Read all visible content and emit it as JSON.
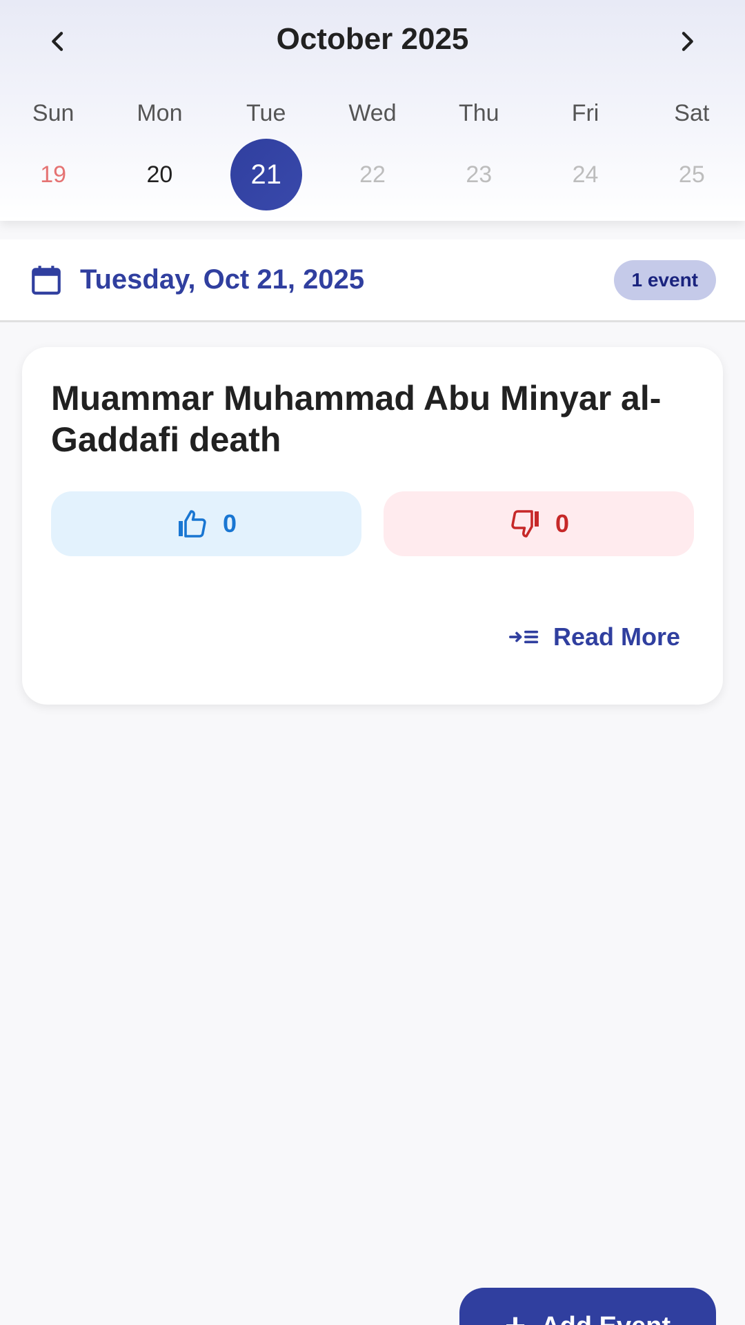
{
  "calendar": {
    "month_title": "October 2025",
    "weekdays": [
      "Sun",
      "Mon",
      "Tue",
      "Wed",
      "Thu",
      "Fri",
      "Sat"
    ],
    "days": [
      "19",
      "20",
      "21",
      "22",
      "23",
      "24",
      "25"
    ],
    "selected_day": "21",
    "colors": {
      "accent": "#303f9f",
      "sunday": "#e57373",
      "future": "#bdbdbd"
    }
  },
  "date_bar": {
    "icon": "calendar-icon",
    "date_title": "Tuesday, Oct 21, 2025",
    "event_count": "1 event"
  },
  "event": {
    "title": "Muammar Muhammad Abu Minyar al-Gaddafi death",
    "likes": "0",
    "dislikes": "0",
    "read_more_label": "Read More",
    "colors": {
      "like_bg": "#e3f2fd",
      "like_fg": "#1976d2",
      "dislike_bg": "#ffebee",
      "dislike_fg": "#c62828"
    }
  },
  "fab": {
    "label": "Add Event",
    "icon": "plus-icon"
  }
}
